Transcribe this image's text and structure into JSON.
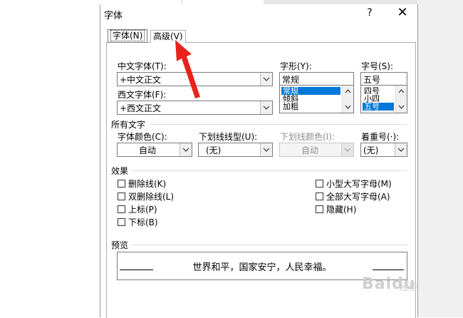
{
  "dialog": {
    "title": "字体",
    "help": "?",
    "close": "✕"
  },
  "tabs": [
    {
      "label": "字体(N)"
    },
    {
      "label": "高级(V)"
    }
  ],
  "font": {
    "chinese_font_label": "中文字体(T):",
    "chinese_font_value": "+中文正文",
    "western_font_label": "西文字体(F):",
    "western_font_value": "+西文正文",
    "style_label": "字形(Y):",
    "style_value": "常规",
    "style_options": [
      "常规",
      "倾斜",
      "加粗"
    ],
    "size_label": "字号(S):",
    "size_value": "五号",
    "size_options": [
      "四号",
      "小四",
      "五号"
    ]
  },
  "all_text": {
    "section_label": "所有文字",
    "font_color_label": "字体颜色(C):",
    "font_color_value": "自动",
    "underline_type_label": "下划线线型(U):",
    "underline_type_value": "(无)",
    "underline_color_label": "下划线颜色(I):",
    "underline_color_value": "自动",
    "emphasis_label": "着重号(·):",
    "emphasis_value": "(无)"
  },
  "effects": {
    "section_label": "效果",
    "left": [
      "删除线(K)",
      "双删除线(L)",
      "上标(P)",
      "下标(B)"
    ],
    "right": [
      "小型大写字母(M)",
      "全部大写字母(A)",
      "隐藏(H)"
    ]
  },
  "preview": {
    "section_label": "预览",
    "text": "世界和平，国家安宁，人民幸福。"
  },
  "watermark": {
    "brand": "Baidu",
    "suffix": "经验"
  },
  "colors": {
    "selection": "#0078d7",
    "arrow": "#e8231b"
  }
}
